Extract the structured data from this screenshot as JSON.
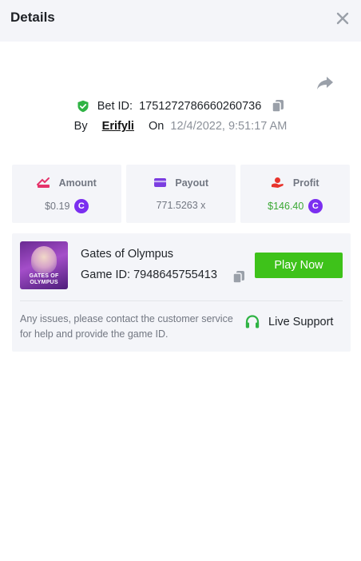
{
  "header": {
    "title": "Details"
  },
  "bet": {
    "id_label": "Bet ID:",
    "id_value": "1751272786660260736",
    "by_label": "By",
    "user": "Erifyli",
    "on_label": "On",
    "date": "12/4/2022, 9:51:17 AM"
  },
  "stats": {
    "amount": {
      "label": "Amount",
      "value": "$0.19"
    },
    "payout": {
      "label": "Payout",
      "value": "771.5263 x"
    },
    "profit": {
      "label": "Profit",
      "value": "$146.40"
    },
    "coin_symbol": "C"
  },
  "game": {
    "name": "Gates of Olympus",
    "id_label": "Game ID:",
    "id_value": "7948645755413",
    "thumb_text_line1": "GATES OF",
    "thumb_text_line2": "OLYMPUS",
    "play_label": "Play Now"
  },
  "support": {
    "help_text": "Any issues, please contact the customer service for help and provide the game ID.",
    "button_label": "Live Support"
  },
  "colors": {
    "accent_green": "#3ec21a",
    "profit_green": "#3aa834",
    "coin_purple": "#7b2ff0",
    "amount_pink": "#e5336b",
    "payout_purple": "#7b3de0",
    "profit_red": "#e8342d",
    "header_bg": "#f4f5f9"
  },
  "icons": {
    "close": "close-icon",
    "share": "share-icon",
    "verified": "shield-check-icon",
    "copy": "copy-icon",
    "amount": "amount-icon",
    "payout": "card-icon",
    "profit": "profit-hand-icon",
    "coin": "coin-icon",
    "support": "headset-icon"
  }
}
